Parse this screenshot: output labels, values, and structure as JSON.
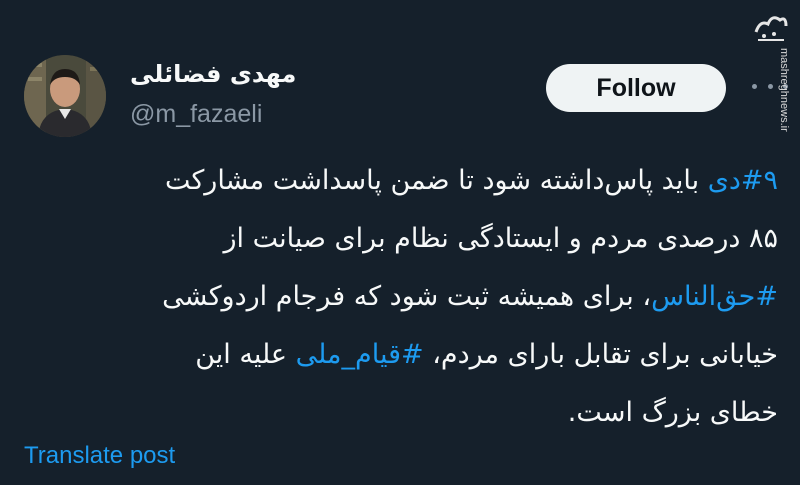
{
  "author": {
    "display_name": "مهدی فضائلی",
    "handle": "@m_fazaeli"
  },
  "follow_button": {
    "label": "Follow"
  },
  "tweet": {
    "lines": [
      [
        {
          "text": "#۹دی",
          "type": "hashtag"
        },
        {
          "text": " باید پاس‌داشته شود تا ضمن پاسداشت مشارکت",
          "type": "text"
        }
      ],
      [
        {
          "text": "۸۵ درصدی مردم و ایستادگی نظام برای صیانت از",
          "type": "text"
        }
      ],
      [
        {
          "text": "#حق‌الناس",
          "type": "hashtag"
        },
        {
          "text": "، برای همیشه ثبت شود که فرجام اردوکشی",
          "type": "text"
        }
      ],
      [
        {
          "text": "خیابانی برای تقابل بارای مردم، ",
          "type": "text"
        },
        {
          "text": "#قیام_ملی",
          "type": "hashtag"
        },
        {
          "text": " علیه این",
          "type": "text"
        }
      ],
      [
        {
          "text": "خطای بزرگ است.",
          "type": "text"
        }
      ]
    ]
  },
  "translate": {
    "label": "Translate post"
  },
  "watermark": {
    "url": "mashreghnews.ir"
  },
  "icons": {
    "more": "more-horizontal-icon",
    "logo": "mashregh-logo"
  },
  "colors": {
    "background": "#15202b",
    "text": "#f7f9f9",
    "secondary_text": "#8b98a5",
    "accent": "#1d9bf0",
    "follow_bg": "#eff3f4"
  }
}
